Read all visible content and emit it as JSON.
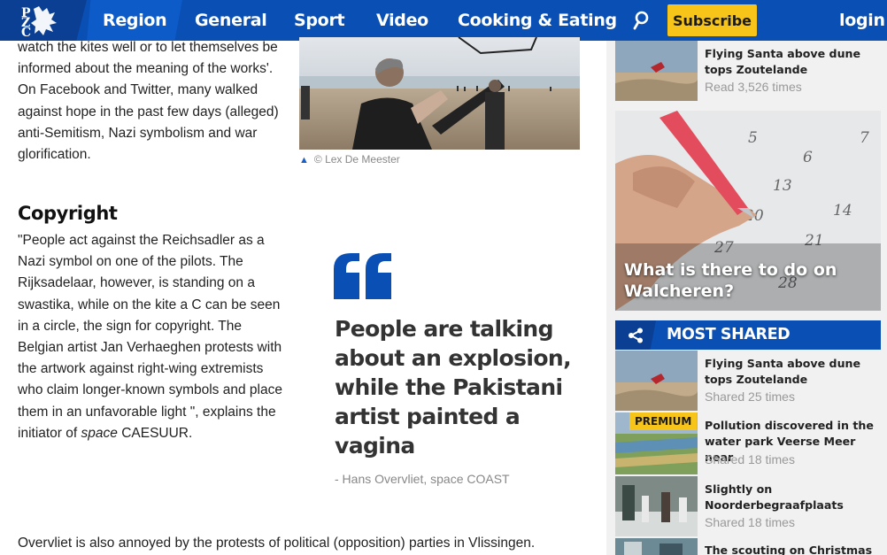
{
  "nav": {
    "logo_text": "PZC",
    "items": [
      "Region",
      "General",
      "Sport",
      "Video",
      "Cooking & Eating"
    ],
    "subscribe": "Subscribe",
    "login": "login",
    "search_icon": "search-icon"
  },
  "article": {
    "p1": "watch the kites well or to let themselves be informed about the meaning of the works'. On Facebook and Twitter, many walked against hope in the past few days (alleged) anti-Semitism, Nazi symbolism and war glorification.",
    "heading": "Copyright",
    "p2_before": "\"People act against the Reichsadler as a Nazi symbol on one of the pilots. The Rijksadelaar, however, is standing on a swastika, while on the kite a C can be seen in a circle, the sign for copyright. The Belgian artist Jan Verhaeghen protests with the artwork against right-wing extremists who claim longer-known symbols and place them in an unfavorable light \", explains the initiator of",
    "p2_em": "space",
    "p2_after": " CAESUUR.",
    "p3": "Overvliet is also annoyed by the protests of political (opposition) parties in Vlissingen.",
    "image_caption": "© Lex De Meester",
    "quote": "People are talking about an explosion, while the Pakistani artist painted a vagina",
    "quote_author": "- Hans Overvliet, space COAST"
  },
  "sidebar": {
    "top_item": {
      "title": "Flying Santa above dune tops Zoutelande",
      "meta": "Read 3,526 times"
    },
    "big_card": {
      "title": "What is there to do on Walcheren?"
    },
    "most_shared_title": "MOST SHARED",
    "most_shared": [
      {
        "title": "Flying Santa above dune tops Zoutelande",
        "meta": "Shared 25 times"
      },
      {
        "title": "Pollution discovered in the water park Veerse Meer near",
        "meta": "Shared 18 times",
        "badge": "PREMIUM"
      },
      {
        "title": "Slightly on Noorderbegraafplaats",
        "meta": "Shared 18 times"
      },
      {
        "title": "The scouting on Christmas visit",
        "meta": ""
      }
    ]
  },
  "colors": {
    "brand_blue": "#0a4fb4",
    "accent_yellow": "#f7c51a"
  }
}
